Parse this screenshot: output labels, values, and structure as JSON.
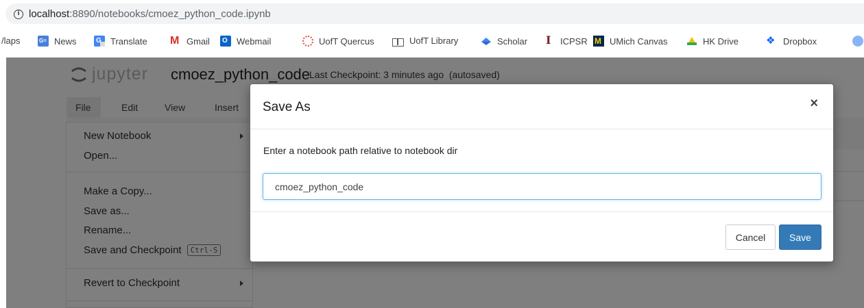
{
  "browser": {
    "url_host": "localhost",
    "url_rest": ":8890/notebooks/cmoez_python_code.ipynb"
  },
  "bookmarks": [
    {
      "label": "/laps",
      "icon": "maps-icon"
    },
    {
      "label": "News",
      "icon": "google-news-icon"
    },
    {
      "label": "Translate",
      "icon": "google-translate-icon"
    },
    {
      "label": "Gmail",
      "icon": "gmail-icon"
    },
    {
      "label": "Webmail",
      "icon": "outlook-icon"
    },
    {
      "label": "UofT Quercus",
      "icon": "quercus-icon"
    },
    {
      "label": "UofT Library",
      "icon": "book-icon"
    },
    {
      "label": "Scholar",
      "icon": "scholar-icon"
    },
    {
      "label": "ICPSR",
      "icon": "icpsr-icon"
    },
    {
      "label": "UMich Canvas",
      "icon": "umich-icon"
    },
    {
      "label": "HK Drive",
      "icon": "google-drive-icon"
    },
    {
      "label": "Dropbox",
      "icon": "dropbox-icon"
    }
  ],
  "jupyter": {
    "logo_text": "jupyter",
    "notebook_name": "cmoez_python_code",
    "checkpoint": "Last Checkpoint: 3 minutes ago  (autosaved)",
    "menu": [
      "File",
      "Edit",
      "View",
      "Insert"
    ]
  },
  "file_menu": {
    "new_notebook": "New Notebook",
    "open": "Open...",
    "make_copy": "Make a Copy...",
    "save_as": "Save as...",
    "rename": "Rename...",
    "save_checkpoint": "Save and Checkpoint",
    "save_checkpoint_shortcut": "Ctrl-S",
    "revert": "Revert to Checkpoint"
  },
  "dialog": {
    "title": "Save As",
    "close": "×",
    "prompt": "Enter a notebook path relative to notebook dir",
    "input_value": "cmoez_python_code",
    "cancel_label": "Cancel",
    "save_label": "Save"
  },
  "colors": {
    "primary_button": "#337ab7",
    "overlay": "#7f7f7f",
    "input_focus": "#66afe9"
  }
}
